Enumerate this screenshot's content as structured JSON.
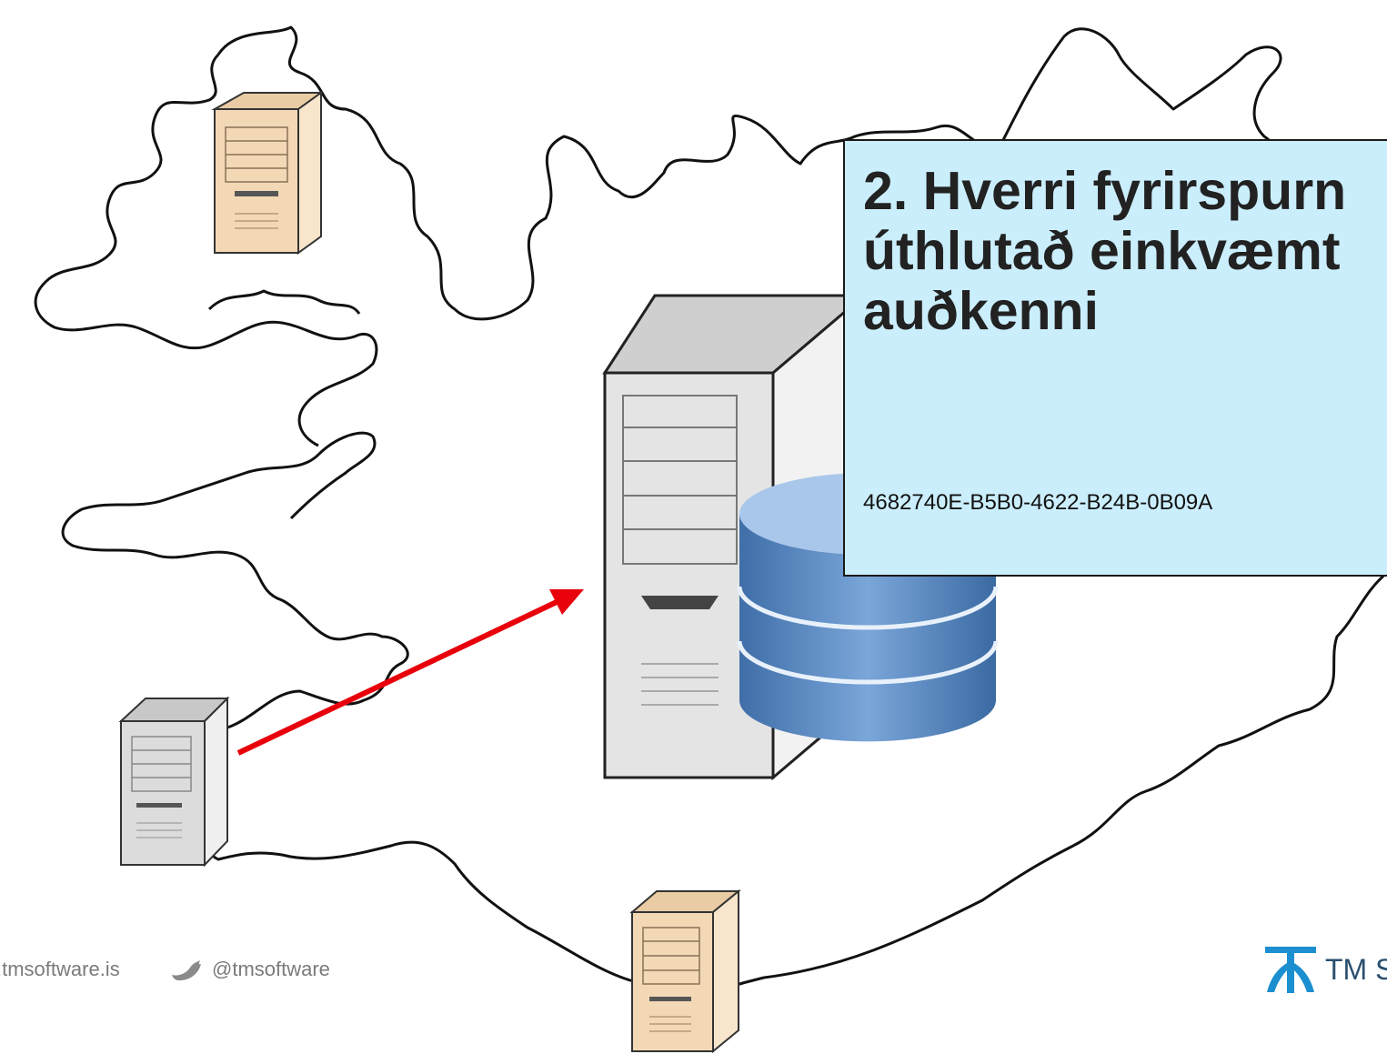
{
  "callout": {
    "title": "2. Hverri fyrirspurn\núthlutað einkvæmt\nauðkenni",
    "guid": "4682740E-B5B0-4622-B24B-0B09A"
  },
  "footer": {
    "website": ".tmsoftware.is",
    "twitter": "@tmsoftware",
    "logo_text": "TM S"
  },
  "colors": {
    "callout_bg": "#cbeefc",
    "arrow": "#e8000b",
    "tan_server": "#f2d8b5",
    "gray_server": "#d9d9d9",
    "database_blue": "#5d8dc4"
  }
}
